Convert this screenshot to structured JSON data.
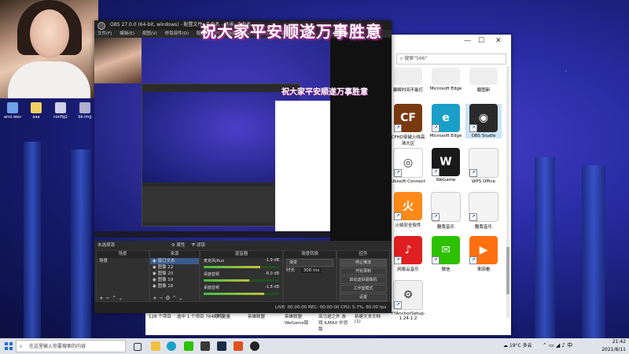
{
  "overlay": {
    "banner": "祝大家平安顺遂万事胜意",
    "banner_nested": "祝大家平安顺遂万事胜意"
  },
  "desktop_icons": [
    {
      "label": "ansi.wav",
      "color": "#6fa0e8"
    },
    {
      "label": "aaa",
      "color": "#f0d060"
    },
    {
      "label": "config1",
      "color": "#d0d0e8"
    },
    {
      "label": "bk.img",
      "color": "#b0b0d0"
    }
  ],
  "explorer": {
    "search_placeholder": "搜索\"566\"",
    "top_labels": [
      "暴瞬时间不能打",
      "Microsoft Edge",
      "截图新"
    ],
    "apps": [
      {
        "label": "CFHD穿越火线高清大区",
        "icon": "cfhd-icon",
        "color": "#7a3a10",
        "glyph": "CF"
      },
      {
        "label": "Microsoft Edge",
        "icon": "edge-icon",
        "color": "#1aa0c8",
        "glyph": "e"
      },
      {
        "label": "OBS Studio",
        "icon": "obs-icon",
        "color": "#2a2a2a",
        "glyph": "◉"
      },
      {
        "label": "Ubisoft Connect",
        "icon": "ubisoft-icon",
        "color": "#ffffff",
        "glyph": "◎"
      },
      {
        "label": "WeGame",
        "icon": "wegame-icon",
        "color": "#1a1a1a",
        "glyph": "W"
      },
      {
        "label": "WPS Office",
        "icon": "wps-icon",
        "color": "#f4f4f4",
        "glyph": ""
      },
      {
        "label": "火绒安全软件",
        "icon": "huorong-icon",
        "color": "#ff8a1a",
        "glyph": "火"
      },
      {
        "label": "酷我音乐",
        "icon": "kuwo-icon",
        "color": "#f4f4f4",
        "glyph": ""
      },
      {
        "label": "酷我音乐",
        "icon": "kuwo-shortcut-icon",
        "color": "#f4f4f4",
        "glyph": ""
      },
      {
        "label": "网易云音乐",
        "icon": "netease-icon",
        "color": "#e02020",
        "glyph": "♪"
      },
      {
        "label": "微信",
        "icon": "wechat-icon",
        "color": "#2dc100",
        "glyph": "✉"
      },
      {
        "label": "来回看",
        "icon": "laihuikan-icon",
        "color": "#ff7010",
        "glyph": "▶"
      },
      {
        "label": "YYAnchorSetup-1.24.1.2",
        "icon": "yy-setup-icon",
        "color": "#f0f0f0",
        "glyph": "⚙"
      }
    ]
  },
  "explorer_status": {
    "count": "128 个项目",
    "selected": "选中 1 个项目  764 字节",
    "bottom_labels": [
      "夹机量量",
      "英雄联盟",
      "英雄联盟WeGame版",
      "亚马逊之外 游戏 ILMAX 中消版",
      "新建文本文档 (1)"
    ]
  },
  "obs": {
    "title": "OBS 27.0.0 (64-bit, windows) - 配置文件: 未命名 - 场景: 未命名",
    "menu": [
      "文件(F)",
      "编辑(E)",
      "视图(V)",
      "停靠部件(D)",
      "配置文件(P)",
      "场景集合(S)",
      "工具(T)",
      "帮助(H)"
    ],
    "no_source": "未选择源",
    "properties": "属性",
    "filters": "滤镜",
    "scenes_header": "场景",
    "scenes": [
      "场景"
    ],
    "sources_header": "来源",
    "sources": [
      "窗口文本",
      "图像 22",
      "图像 20",
      "图像 19",
      "图像 18"
    ],
    "mixer_header": "混音器",
    "mixer": [
      {
        "name": "麦克风/Aux",
        "db": "-1.9 dB",
        "level": 0.75
      },
      {
        "name": "桌面音频",
        "db": "-8.0 dB",
        "level": 0.6
      },
      {
        "name": "桌面音频",
        "db": "-1.8 dB",
        "level": 0.8
      }
    ],
    "transitions_header": "场景转换",
    "transition_value": "渐变",
    "duration_label": "时长",
    "duration_value": "300 ms",
    "controls_header": "控件",
    "controls": [
      "停止推流",
      "开始录制",
      "启动虚拟摄像机",
      "工作室模式",
      "设置",
      "退出"
    ],
    "status": "LIVE: 00:00:00   REC: 00:00:00   CPU: 5.7%, 60.00 fps"
  },
  "taskbar": {
    "search_placeholder": "在这里输入你要搜索的内容",
    "weather": "19°C 多云",
    "time": "21:42",
    "date": "2021/8/11"
  },
  "colors": {
    "accent": "#1e6fd9",
    "obs_bg": "#2b2b2b",
    "selected_tile": "#cce4f7"
  }
}
